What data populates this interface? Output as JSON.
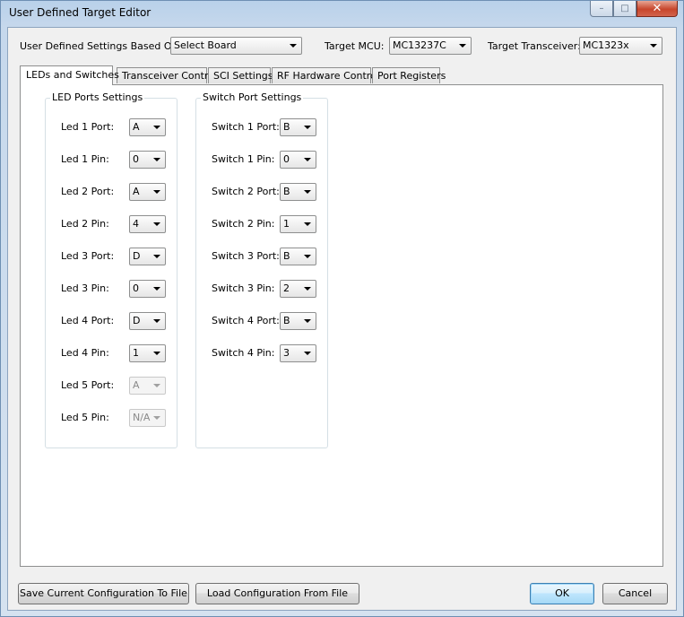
{
  "window": {
    "title": "User Defined Target Editor",
    "minimize_glyph": "–",
    "maximize_glyph": "□",
    "close_glyph": "✕"
  },
  "header": {
    "settings_based_on_label": "User Defined Settings Based On:",
    "settings_based_on_value": "Select Board",
    "target_mcu_label": "Target MCU:",
    "target_mcu_value": "MC13237C",
    "target_transceiver_label": "Target Transceiver:",
    "target_transceiver_value": "MC1323x"
  },
  "tabs": [
    {
      "label": "LEDs and Switches",
      "active": true
    },
    {
      "label": "Transceiver Control",
      "active": false
    },
    {
      "label": "SCI Settings",
      "active": false
    },
    {
      "label": "RF Hardware Control",
      "active": false
    },
    {
      "label": "Port Registers",
      "active": false
    }
  ],
  "led_group": {
    "title": "LED Ports Settings",
    "rows": [
      {
        "label": "Led 1 Port:",
        "value": "A",
        "enabled": true
      },
      {
        "label": "Led 1 Pin:",
        "value": "0",
        "enabled": true
      },
      {
        "label": "Led 2 Port:",
        "value": "A",
        "enabled": true
      },
      {
        "label": "Led 2 Pin:",
        "value": "4",
        "enabled": true
      },
      {
        "label": "Led 3 Port:",
        "value": "D",
        "enabled": true
      },
      {
        "label": "Led 3 Pin:",
        "value": "0",
        "enabled": true
      },
      {
        "label": "Led 4 Port:",
        "value": "D",
        "enabled": true
      },
      {
        "label": "Led 4 Pin:",
        "value": "1",
        "enabled": true
      },
      {
        "label": "Led 5 Port:",
        "value": "A",
        "enabled": false
      },
      {
        "label": "Led 5 Pin:",
        "value": "N/A",
        "enabled": false
      }
    ]
  },
  "switch_group": {
    "title": "Switch Port Settings",
    "rows": [
      {
        "label": "Switch 1 Port:",
        "value": "B",
        "enabled": true
      },
      {
        "label": "Switch 1 Pin:",
        "value": "0",
        "enabled": true
      },
      {
        "label": "Switch 2 Port:",
        "value": "B",
        "enabled": true
      },
      {
        "label": "Switch 2 Pin:",
        "value": "1",
        "enabled": true
      },
      {
        "label": "Switch 3 Port:",
        "value": "B",
        "enabled": true
      },
      {
        "label": "Switch 3 Pin:",
        "value": "2",
        "enabled": true
      },
      {
        "label": "Switch 4 Port:",
        "value": "B",
        "enabled": true
      },
      {
        "label": "Switch 4 Pin:",
        "value": "3",
        "enabled": true
      }
    ]
  },
  "footer": {
    "save_label": "Save Current Configuration To File",
    "load_label": "Load Configuration From File",
    "ok_label": "OK",
    "cancel_label": "Cancel"
  }
}
